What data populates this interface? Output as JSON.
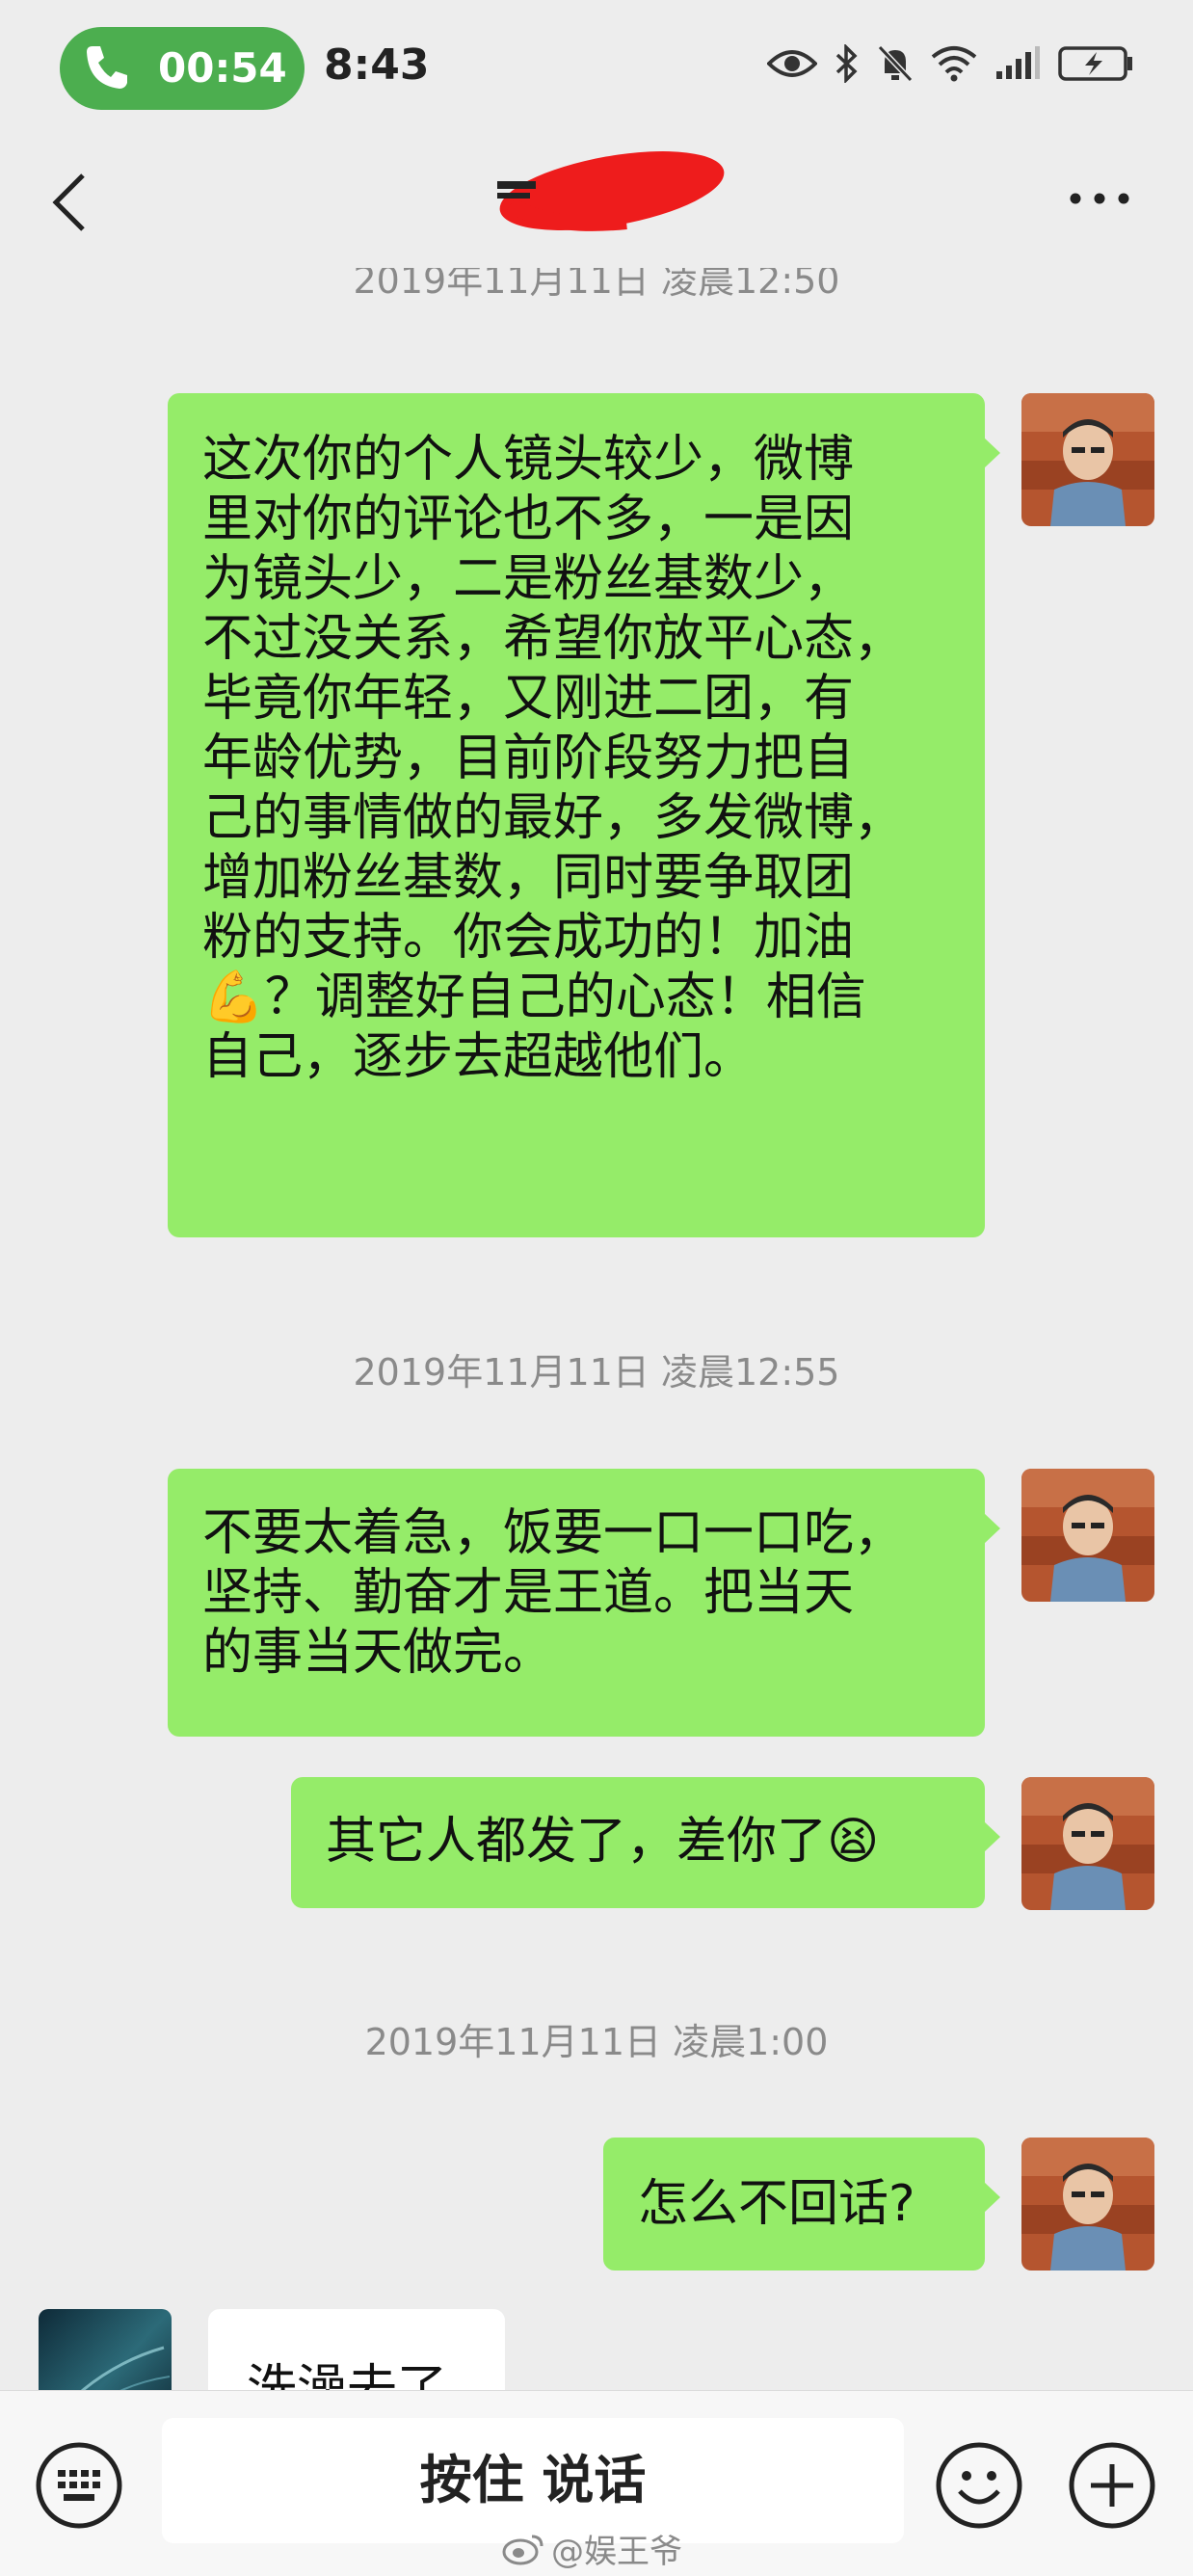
{
  "status_bar": {
    "call_timer": "00:54",
    "clock": "8:43",
    "icons": [
      "eye-icon",
      "bluetooth-icon",
      "mute-bell-icon",
      "wifi-icon",
      "signal-icon",
      "battery-charging-icon"
    ]
  },
  "header": {
    "back_icon": "chevron-left-icon",
    "more_icon": "more-dots-icon"
  },
  "messages": {
    "ts0": "2019年11月11日 凌晨12:50",
    "m1": [
      "这次你的个人镜头较少，微博",
      "里对你的评论也不多，一是因",
      "为镜头少，二是粉丝基数少，",
      "不过没关系，希望你放平心态，",
      "毕竟你年轻，又刚进二团，有",
      "年龄优势，目前阶段努力把自",
      "己的事情做的最好，多发微博，",
      "增加粉丝基数，同时要争取团",
      "粉的支持。你会成功的！加油",
      "💪？调整好自己的心态！相信",
      "自己，逐步去超越他们。"
    ],
    "ts1": "2019年11月11日 凌晨12:55",
    "m2": [
      "不要太着急，饭要一口一口吃，",
      "坚持、勤奋才是王道。把当天",
      "的事当天做完。"
    ],
    "m3": "其它人都发了，差你了😫",
    "ts2": "2019年11月11日 凌晨1:00",
    "m4": "怎么不回话?",
    "reply": "洗澡去了"
  },
  "bottom_bar": {
    "talk_label": "按住 说话",
    "watermark": "@娱王爷"
  },
  "colors": {
    "bubble_green": "#95ec69",
    "call_pill": "#4cae4f",
    "background": "#ededed"
  }
}
